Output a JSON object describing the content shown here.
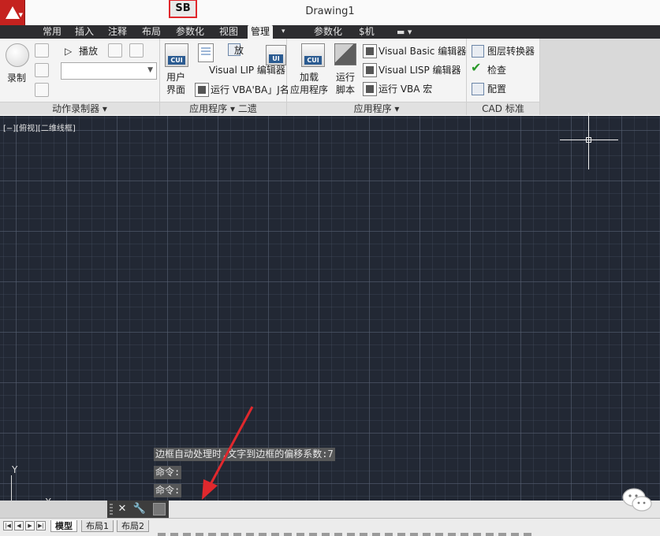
{
  "window": {
    "title": "Drawing1"
  },
  "tabs": [
    {
      "label": "常用",
      "active": false
    },
    {
      "label": "插入",
      "active": false
    },
    {
      "label": "注释",
      "active": false
    },
    {
      "label": "布局",
      "active": false
    },
    {
      "label": "参数化",
      "active": false
    },
    {
      "label": "视图",
      "active": false
    },
    {
      "label": "管理",
      "active": true
    },
    {
      "label": "参数化",
      "active": false
    },
    {
      "label": "$机",
      "active": false
    }
  ],
  "ribbon": {
    "action_recorder": {
      "record_label": "录制",
      "play_label": "播放",
      "panel_title": "动作录制器 ▾"
    },
    "customization": {
      "user_label_1": "用户",
      "user_label_2": "界面",
      "playback_label": "放",
      "vlisp_label": "Visual LIP 编辑器",
      "run_vba_label": "运行 VBA'BA」J名",
      "panel_title": "应用程序 ▾ 二遗"
    },
    "applications": {
      "load_label_1": "加载",
      "load_label_2": "应用程序",
      "run_script_label_1": "运行",
      "run_script_label_2": "脚本",
      "vb_editor_label": "Visual Basic 编辑器",
      "vlisp_editor_label": "Visual LISP 编辑器",
      "run_vba_macro_label": "运行 VBA 宏",
      "panel_title": "应用程序 ▾"
    },
    "cad_standards": {
      "layer_translator_label": "图层转换器",
      "check_label": "检查",
      "configure_label": "配置",
      "panel_title": "CAD 标准"
    }
  },
  "viewport": {
    "label": "[−][俯视][二维线框]"
  },
  "ucs": {
    "x_label": "X",
    "y_label": "Y"
  },
  "command_history": [
    "边框自动处理时,文字到边框的偏移系数:7",
    "命令:",
    "命令:"
  ],
  "command_line": {
    "value": "SB"
  },
  "layout_tabs": [
    {
      "label": "模型",
      "active": true
    },
    {
      "label": "布局1",
      "active": false
    },
    {
      "label": "布局2",
      "active": false
    }
  ],
  "colors": {
    "canvas_bg": "#222834",
    "annotation": "#e0282d",
    "active_tab_bg": "#f3f3f3"
  }
}
